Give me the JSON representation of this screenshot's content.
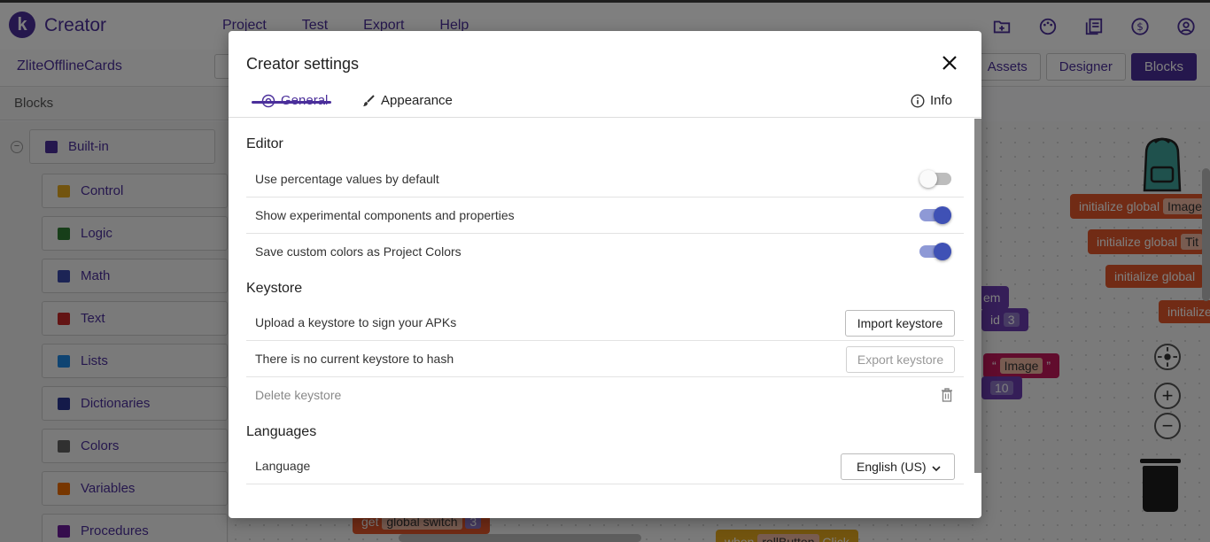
{
  "app": {
    "logo_letter": "k",
    "brand": "Creator",
    "menu": [
      "Project",
      "Test",
      "Export",
      "Help"
    ],
    "top_icons": [
      "folder-add-icon",
      "palette-icon",
      "library-icon",
      "dollar-icon",
      "account-icon"
    ]
  },
  "project": {
    "name": "ZliteOfflineCards",
    "views": [
      "Assets",
      "Designer",
      "Blocks"
    ],
    "active_view": "Blocks"
  },
  "blocks_panel": {
    "title": "Blocks",
    "builtin_label": "Built-in",
    "categories": [
      {
        "label": "Control",
        "color": "#e5a81f"
      },
      {
        "label": "Logic",
        "color": "#2e7d32"
      },
      {
        "label": "Math",
        "color": "#3949ab"
      },
      {
        "label": "Text",
        "color": "#c62828"
      },
      {
        "label": "Lists",
        "color": "#1e88e5"
      },
      {
        "label": "Dictionaries",
        "color": "#283593"
      },
      {
        "label": "Colors",
        "color": "#616161"
      },
      {
        "label": "Variables",
        "color": "#ef6c00"
      },
      {
        "label": "Procedures",
        "color": "#6a1b9a"
      }
    ]
  },
  "workspace": {
    "blocks": {
      "init_image": "initialize global",
      "init_image_slot": "Image",
      "init_title": "initialize global",
      "init_title_slot": "Tit",
      "init_3": "initialize global",
      "init_4": "initialize",
      "item_text": "em",
      "id_text": "id",
      "id_value": "3",
      "image_text": "Image",
      "num_10": "10",
      "get_text": "get",
      "global_switch": "global switch",
      "num_3": "3",
      "when_text": "when",
      "roll_button": "rollButton",
      "click_text": "Click"
    }
  },
  "dialog": {
    "title": "Creator settings",
    "tabs": {
      "general": "General",
      "appearance": "Appearance",
      "info": "Info"
    },
    "editor": {
      "title": "Editor",
      "rows": [
        {
          "label": "Use percentage values by default",
          "on": false
        },
        {
          "label": "Show experimental components and properties",
          "on": true
        },
        {
          "label": "Save custom colors as Project Colors",
          "on": true
        }
      ]
    },
    "keystore": {
      "title": "Keystore",
      "upload_label": "Upload a keystore to sign your APKs",
      "import_button": "Import keystore",
      "hash_label": "There is no current keystore to hash",
      "export_button": "Export keystore",
      "delete_label": "Delete keystore"
    },
    "languages": {
      "title": "Languages",
      "language_label": "Language",
      "language_value": "English (US)"
    }
  }
}
